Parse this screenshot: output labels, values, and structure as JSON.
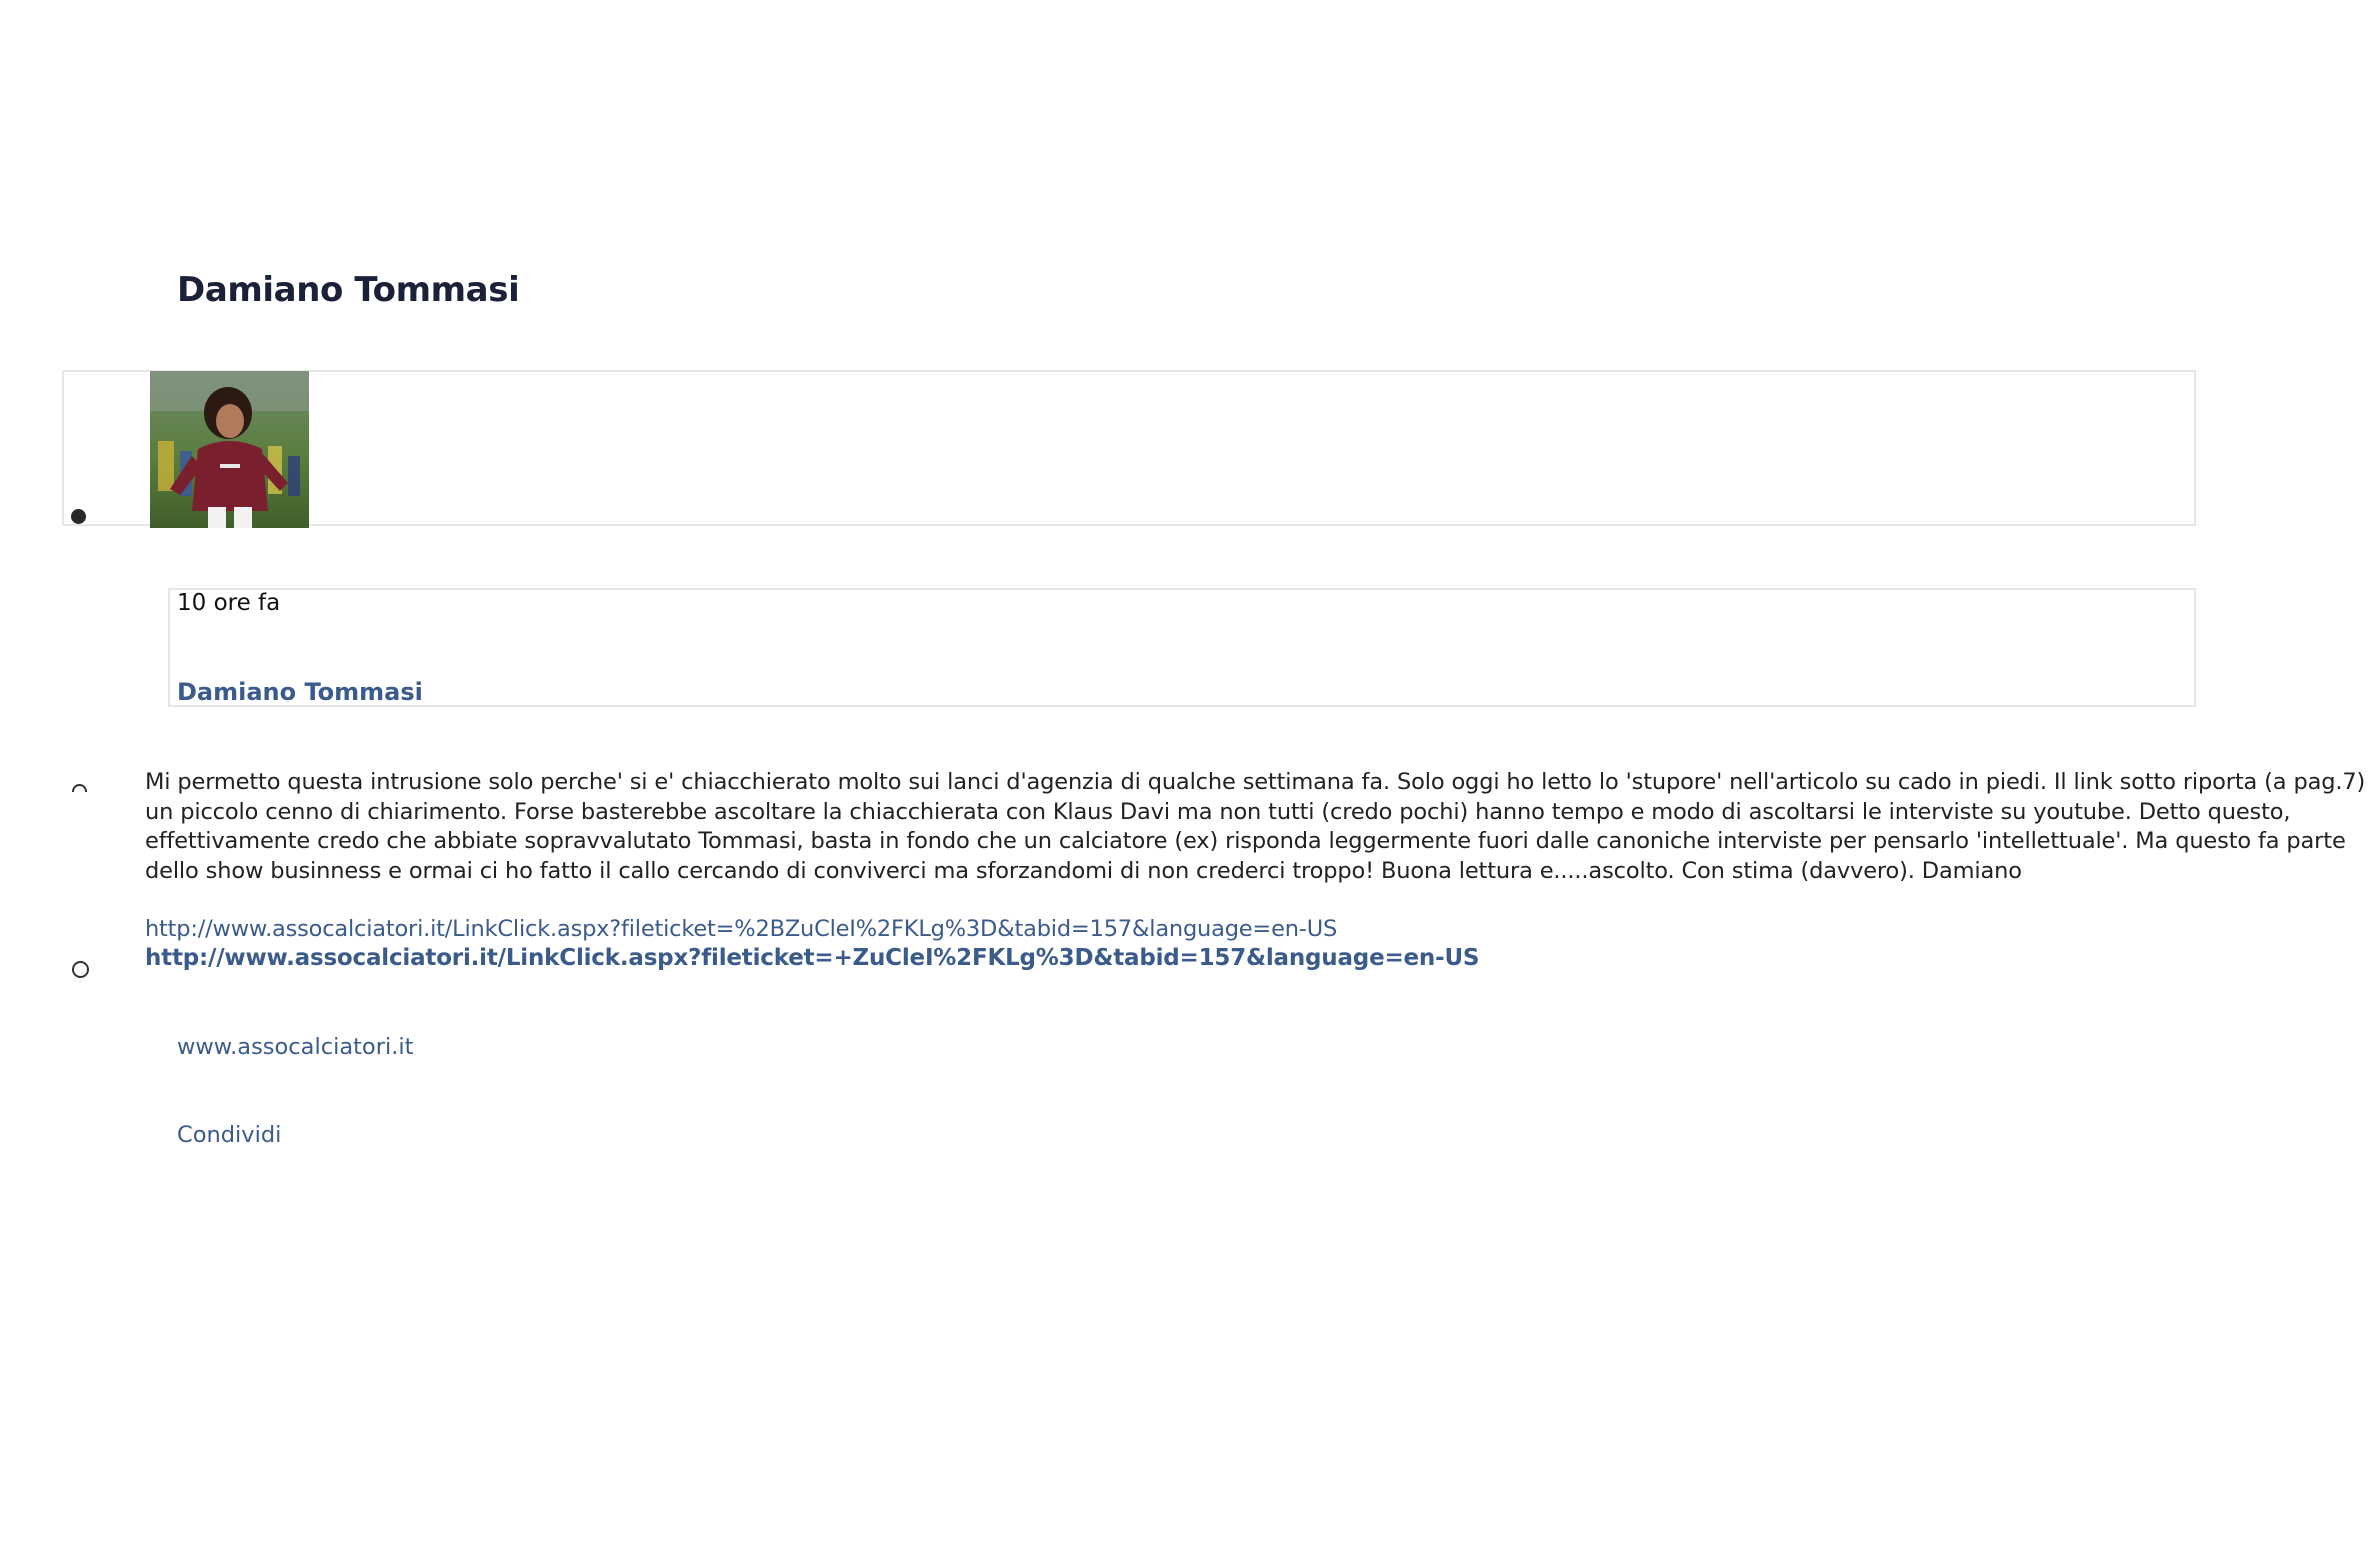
{
  "post": {
    "title": "Damiano Tommasi",
    "avatar_alt": "Damiano Tommasi"
  },
  "meta": {
    "timestamp": "10 ore fa",
    "author": "Damiano Tommasi"
  },
  "comment": {
    "lines": [
      "Mi permetto questa intrusione solo perche' si e' chiacchierato molto sui lanci d'agenzia di qualche settimana fa. Solo oggi ho letto lo 'stupore' nell'articolo su cado in piedi. Il link sotto riporta (a pag.7)",
      "un piccolo cenno di chiarimento. Forse basterebbe ascoltare la chiacchierata con Klaus Davi ma non tutti (credo pochi) hanno tempo e modo di ascoltarsi le interviste su youtube. Detto questo,",
      "effettivamente credo che abbiate sopravvalutato Tommasi, basta in fondo che un calciatore (ex) risponda leggermente fuori dalle canoniche interviste per pensarlo 'intellettuale'. Ma questo fa parte",
      "dello show businness e ormai ci ho fatto il callo cercando di conviverci ma sforzandomi di non crederci troppo! Buona lettura e.....ascolto. Con stima (davvero). Damiano"
    ]
  },
  "attachment": {
    "url_plain": "http://www.assocalciatori.it/LinkClick.aspx?fileticket=%2BZuCleI%2FKLg%3D&tabid=157&language=en-US",
    "url_title": "http://www.assocalciatori.it/LinkClick.aspx?fileticket=+ZuCleI%2FKLg%3D&tabid=157&language=en-US",
    "domain": "www.assocalciatori.it"
  },
  "actions": {
    "share_label": "Condividi"
  },
  "colors": {
    "title": "#1a2139",
    "link": "#3b5b8c",
    "text": "#222222",
    "border": "#e6e6e6"
  }
}
